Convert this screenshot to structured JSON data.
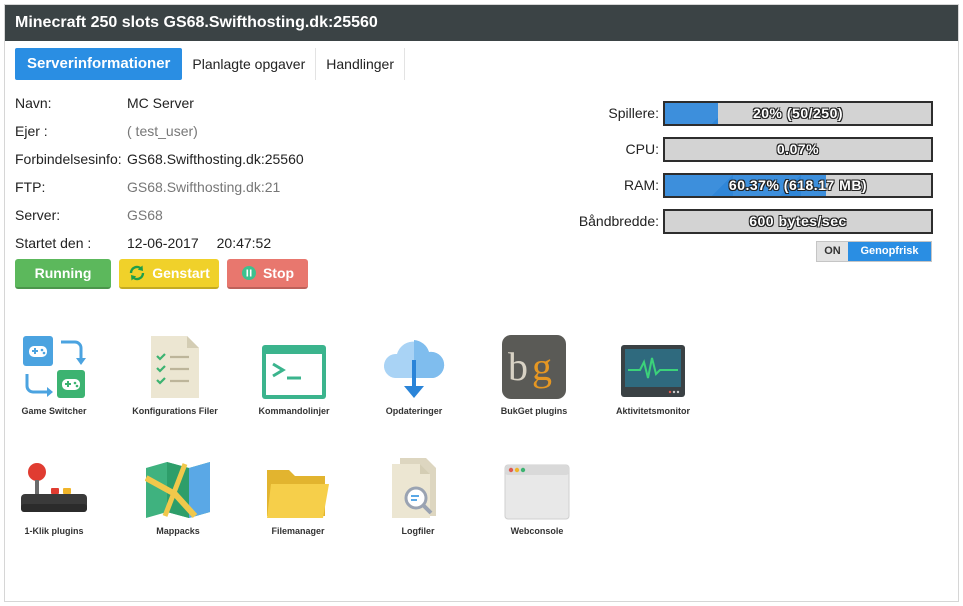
{
  "header": {
    "title": "Minecraft 250 slots GS68.Swifthosting.dk:25560"
  },
  "tabs": [
    {
      "label": "Serverinformationer",
      "active": true
    },
    {
      "label": "Planlagte opgaver",
      "active": false
    },
    {
      "label": "Handlinger",
      "active": false
    }
  ],
  "info": {
    "name_label": "Navn:",
    "name_value": "MC Server",
    "owner_label": "Ejer :",
    "owner_value": "( test_user)",
    "conn_label": "Forbindelsesinfo:",
    "conn_value": "GS68.Swifthosting.dk:25560",
    "ftp_label": "FTP:",
    "ftp_value": "GS68.Swifthosting.dk:21",
    "server_label": "Server:",
    "server_value": "GS68",
    "started_label": "Startet den :",
    "started_date": "12-06-2017",
    "started_time": "20:47:52"
  },
  "buttons": {
    "running": "Running",
    "restart": "Genstart",
    "stop": "Stop"
  },
  "stats": {
    "players_label": "Spillere:",
    "players_text": "20% (50/250)",
    "players_fraction": 0.2,
    "cpu_label": "CPU:",
    "cpu_text": "0.07%",
    "cpu_fraction": 0.0007,
    "ram_label": "RAM:",
    "ram_text": "60.37% (618.17 MB)",
    "ram_fraction": 0.6037,
    "bw_label": "Båndbredde:",
    "bw_text": "600 bytes/sec",
    "bw_fraction": 0
  },
  "refresh": {
    "on_label": "ON",
    "refresh_label": "Genopfrisk"
  },
  "apps": [
    {
      "label": "Game Switcher",
      "icon": "game-switcher-icon"
    },
    {
      "label": "Konfigurations Filer",
      "icon": "config-files-icon"
    },
    {
      "label": "Kommandolinjer",
      "icon": "terminal-icon"
    },
    {
      "label": "Opdateringer",
      "icon": "cloud-download-icon"
    },
    {
      "label": "BukGet plugins",
      "icon": "bukget-icon"
    },
    {
      "label": "Aktivitetsmonitor",
      "icon": "activity-monitor-icon"
    },
    {
      "label": "1-Klik plugins",
      "icon": "joystick-icon"
    },
    {
      "label": "Mappacks",
      "icon": "map-icon"
    },
    {
      "label": "Filemanager",
      "icon": "folder-icon"
    },
    {
      "label": "Logfiler",
      "icon": "log-search-icon"
    },
    {
      "label": "Webconsole",
      "icon": "browser-window-icon"
    }
  ]
}
